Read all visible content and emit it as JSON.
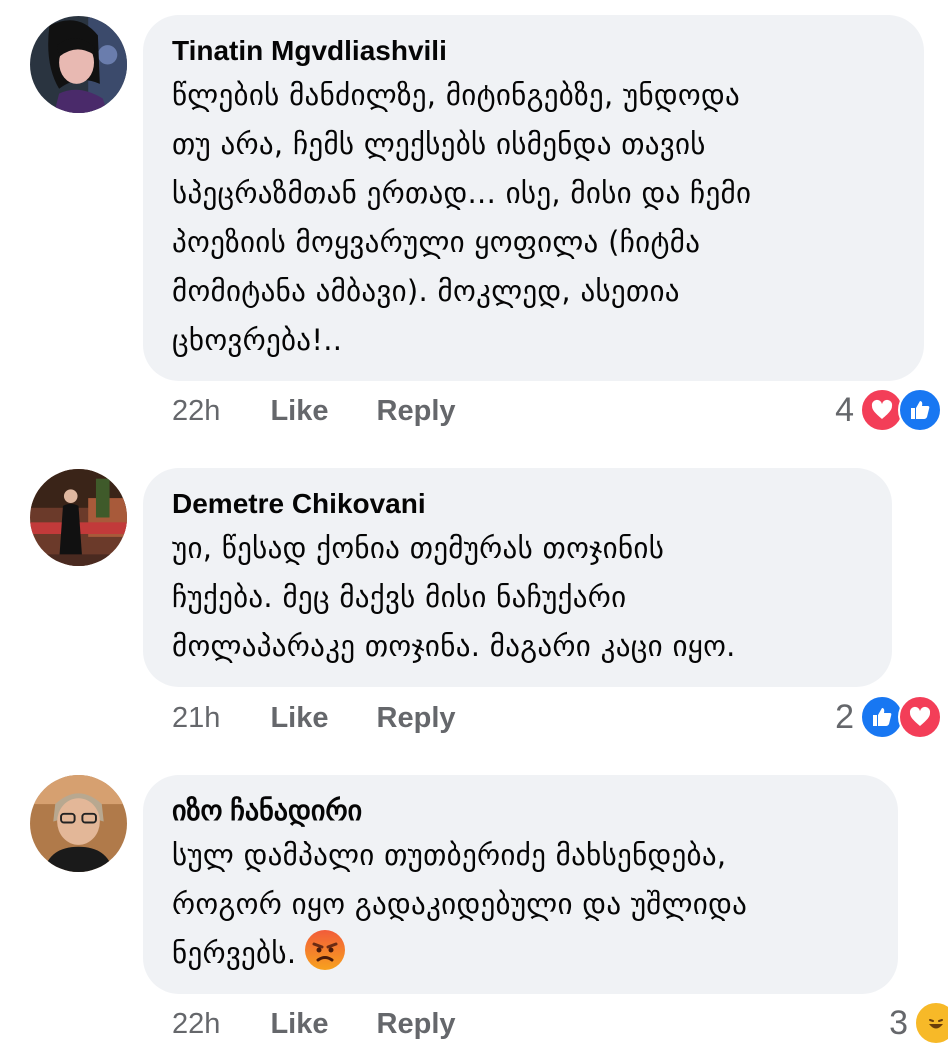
{
  "comments": [
    {
      "author": "Tinatin Mgvdliashvili",
      "lines": [
        "წლების მანძილზე, მიტინგებზე, უნდოდა",
        "თუ არა, ჩემს ლექსებს ისმენდა თავის",
        "სპეცრაზმთან ერთად... ისე, მისი და ჩემი",
        "პოეზიის მოყვარული ყოფილა (ჩიტმა",
        "მომიტანა ამბავი). მოკლედ, ასეთია",
        "ცხოვრება!.."
      ],
      "time": "22h",
      "like_label": "Like",
      "reply_label": "Reply",
      "reaction_count": "4",
      "reactions": [
        "love-icon",
        "like-icon"
      ]
    },
    {
      "author": "Demetre Chikovani",
      "lines": [
        "უი, წესად ქონია თემურას  თოჯინის",
        "ჩუქება. მეც მაქვს მისი ნაჩუქარი",
        "მოლაპარაკე თოჯინა. მაგარი კაცი იყო."
      ],
      "time": "21h",
      "like_label": "Like",
      "reply_label": "Reply",
      "reaction_count": "2",
      "reactions": [
        "like-icon",
        "love-icon"
      ]
    },
    {
      "author": "იზო ჩანადირი",
      "lines": [
        "სულ დამპალი თუთბერიძე მახსენდება,",
        "როგორ იყო გადაკიდებული და უშლიდა",
        "ნერვებს."
      ],
      "inline_emoji": "angry-face-emoji",
      "time": "22h",
      "like_label": "Like",
      "reply_label": "Reply",
      "reaction_count": "3",
      "reactions": [
        "haha-icon"
      ]
    }
  ],
  "colors": {
    "bubble": "#f0f2f5",
    "text": "#050505",
    "meta": "#65676b",
    "like": "#1877f2",
    "love": "#f33e58",
    "haha": "#f7b928"
  }
}
